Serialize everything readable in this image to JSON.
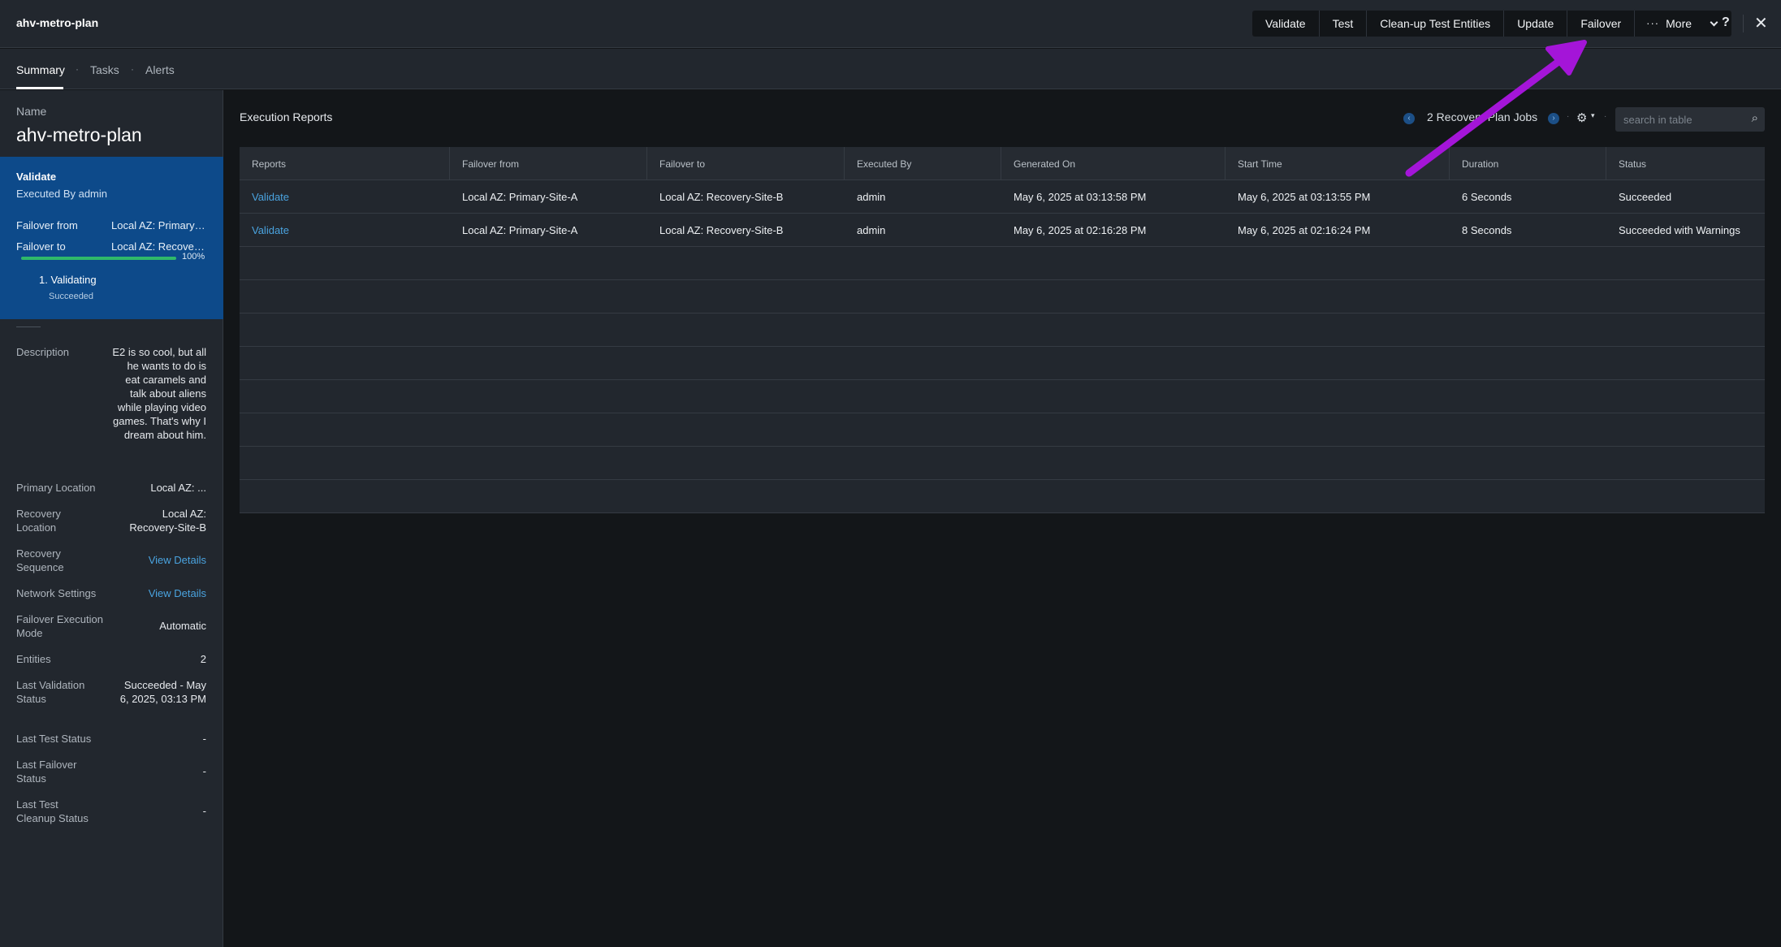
{
  "app": {
    "title": "ahv-metro-plan"
  },
  "toolbar": {
    "actions": [
      "Validate",
      "Test",
      "Clean-up Test Entities",
      "Update",
      "Failover"
    ],
    "more_dots": "···",
    "more_label": "More",
    "help": "?",
    "close": "✕"
  },
  "tabs": [
    {
      "label": "Summary",
      "active": true
    },
    {
      "label": "Tasks",
      "active": false
    },
    {
      "label": "Alerts",
      "active": false
    }
  ],
  "tab_separator": "·",
  "left": {
    "name_label": "Name",
    "name_value": "ahv-metro-plan",
    "job": {
      "title": "Validate",
      "executed_by": "Executed By admin",
      "failover_from_label": "Failover from",
      "failover_from_value": "Local AZ: Primary-Site-A",
      "failover_to_label": "Failover to",
      "failover_to_value": "Local AZ: Recovery-Site-B",
      "progress_fraction": 1.0,
      "progress_label": "100%",
      "step_title": "1. Validating",
      "step_status": "Succeeded"
    },
    "properties": [
      {
        "key": "Description",
        "value": "E2 is so cool, but all he wants to do is eat caramels and talk about aliens while playing video games. That's why I dream about him."
      },
      {
        "key": "Primary Location",
        "value": "Local AZ: ..."
      },
      {
        "key": "Recovery Location",
        "value": "Local AZ: Recovery-Site-B"
      },
      {
        "key": "Recovery Sequence",
        "value": "View Details"
      },
      {
        "key": "Network Settings",
        "value": "View Details"
      },
      {
        "key": "Failover Execution Mode",
        "value": "Automatic"
      },
      {
        "key": "Entities",
        "value": "2"
      },
      {
        "key": "Last Validation Status",
        "value": "Succeeded - May 6, 2025, 03:13 PM"
      },
      {
        "key": "Last Test Status",
        "value": "-"
      },
      {
        "key": "Last Failover Status",
        "value": "-"
      },
      {
        "key": "Last Test Cleanup Status",
        "value": "-"
      }
    ]
  },
  "main": {
    "title": "Execution Reports",
    "pager_text": "2 Recovery Plan Jobs",
    "search_placeholder": "search in table",
    "columns": [
      "Reports",
      "Failover from",
      "Failover to",
      "Executed By",
      "Generated On",
      "Start Time",
      "Duration",
      "Status"
    ],
    "rows": [
      [
        "Validate",
        "Local AZ: Primary-Site-A",
        "Local AZ: Recovery-Site-B",
        "admin",
        "May 6, 2025 at 03:13:58 PM",
        "May 6, 2025 at 03:13:55 PM",
        "6 Seconds",
        "Succeeded"
      ],
      [
        "Validate",
        "Local AZ: Primary-Site-A",
        "Local AZ: Recovery-Site-B",
        "admin",
        "May 6, 2025 at 02:16:28 PM",
        "May 6, 2025 at 02:16:24 PM",
        "8 Seconds",
        "Succeeded with Warnings"
      ]
    ],
    "empty_rows": 8
  },
  "colors": {
    "accent_link": "#4aa3df",
    "job_card": "#0d4a8a",
    "progress": "#2fb96a",
    "annotation_arrow": "#a415d8"
  }
}
